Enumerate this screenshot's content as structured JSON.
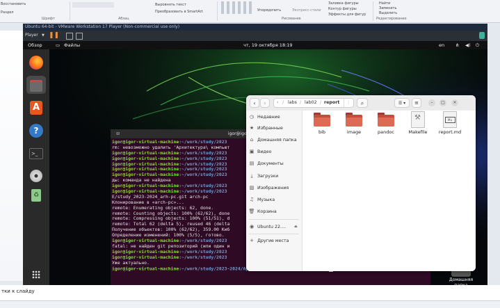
{
  "ppt": {
    "ribbon": {
      "left_label": "Восстановить",
      "left_label2": "Раздел",
      "text_align": "Выровнять текст",
      "to_smartart": "Преобразовать в SmartArt",
      "arrange": "Упорядочить",
      "quick_styles": "Экспресс-стили",
      "shape_fill": "Заливка фигуры",
      "shape_outline": "Контур фигуры",
      "shape_effects": "Эффекты для фигур",
      "find": "Найти",
      "replace": "Заменить",
      "select": "Выделить",
      "group_font": "Шрифт",
      "group_paragraph": "Абзац",
      "group_drawing": "Рисование",
      "group_editing": "Редактирование"
    },
    "notes_placeholder": "тки к слайду"
  },
  "vmware": {
    "title": "Ubuntu 64-bit - VMware Workstation 17 Player (Non-commercial use only)",
    "player_label": "Player"
  },
  "gnome": {
    "overview": "Обзор",
    "files_app": "Файлы",
    "clock": "чт, 19 октября  18:19",
    "lang": "en"
  },
  "terminal": {
    "title": "igor@igor-virtual-machine: ~/work/study",
    "lines": [
      {
        "user": "igor@igor-virtual-machine",
        "path": ":~/work/study/2023",
        "text": ""
      },
      {
        "user": "",
        "path": "",
        "text": "rm: невозможно удалить 'Архитектура\\ компьют"
      },
      {
        "user": "igor@igor-virtual-machine",
        "path": ":~/work/study/2023",
        "text": ""
      },
      {
        "user": "igor@igor-virtual-machine",
        "path": ":~/work/study/2023",
        "text": ""
      },
      {
        "user": "igor@igor-virtual-machine",
        "path": ":~/work/study/2023",
        "text": ""
      },
      {
        "user": "igor@igor-virtual-machine",
        "path": ":~/work/study/2023",
        "text": ""
      },
      {
        "user": "igor@igor-virtual-machine",
        "path": ":~/work/study/2023",
        "text": ""
      },
      {
        "user": "",
        "path": "",
        "text": "ды: команда не найдена"
      },
      {
        "user": "igor@igor-virtual-machine",
        "path": ":~/work/study/2023",
        "text": ""
      },
      {
        "user": "igor@igor-virtual-machine",
        "path": ":~/work/study/2023",
        "text": ""
      },
      {
        "user": "",
        "path": "",
        "text": "E/study_2023-2024_arh-pc.git arch-pc"
      },
      {
        "user": "",
        "path": "",
        "text": "Клонирование в «arch-pc»..."
      },
      {
        "user": "",
        "path": "",
        "text": "remote: Enumerating objects: 62, done."
      },
      {
        "user": "",
        "path": "",
        "text": "remote: Counting objects: 100% (62/62), done"
      },
      {
        "user": "",
        "path": "",
        "text": "remote: Compressing objects: 100% (51/51), d"
      },
      {
        "user": "",
        "path": "",
        "text": "remote: Total 62 (delta 5), reused 46 (delta"
      },
      {
        "user": "",
        "path": "",
        "text": "Получение объектов: 100% (62/62), 359.00 Киб"
      },
      {
        "user": "",
        "path": "",
        "text": "Определение изменений: 100% (5/5), готово."
      },
      {
        "user": "igor@igor-virtual-machine",
        "path": ":~/work/study/2023",
        "text": ""
      },
      {
        "user": "",
        "path": "",
        "text": "fatal: не найден git репозиторий (или один и"
      },
      {
        "user": "igor@igor-virtual-machine",
        "path": ":~/work/study/2023",
        "text": ""
      },
      {
        "user": "igor@igor-virtual-machine",
        "path": ":~/work/study/2023",
        "text": ""
      },
      {
        "user": "",
        "path": "",
        "text": "Уже актуально."
      },
      {
        "user": "igor@igor-virtual-machine",
        "path": ":~/work/study/2023-2024/Архитектура компьютера/arch-pc",
        "text": "$ "
      }
    ]
  },
  "files": {
    "breadcrumb": [
      "labs",
      "lab02",
      "report"
    ],
    "sidebar": [
      {
        "icon": "clock-icon",
        "glyph": "◷",
        "label": "Недавние"
      },
      {
        "icon": "star-icon",
        "glyph": "★",
        "label": "Избранные"
      },
      {
        "icon": "home-icon",
        "glyph": "⌂",
        "label": "Домашняя папка"
      },
      {
        "icon": "video-icon",
        "glyph": "▣",
        "label": "Видео"
      },
      {
        "icon": "document-icon",
        "glyph": "▤",
        "label": "Документы"
      },
      {
        "icon": "download-icon",
        "glyph": "⤓",
        "label": "Загрузки"
      },
      {
        "icon": "image-icon",
        "glyph": "▨",
        "label": "Изображения"
      },
      {
        "icon": "music-icon",
        "glyph": "♫",
        "label": "Музыка"
      },
      {
        "icon": "trash-icon",
        "glyph": "🗑",
        "label": "Корзина"
      },
      {
        "icon": "disc-icon",
        "glyph": "◉",
        "label": "Ubuntu 22...."
      },
      {
        "icon": "plus-icon",
        "glyph": "+",
        "label": "Другие места"
      }
    ],
    "items": [
      {
        "name": "bib",
        "type": "folder"
      },
      {
        "name": "image",
        "type": "folder"
      },
      {
        "name": "pandoc",
        "type": "folder"
      },
      {
        "name": "Makefile",
        "type": "script"
      },
      {
        "name": "report.md",
        "type": "markdown"
      }
    ]
  },
  "desktop": {
    "home_label": "Домашняя папка"
  }
}
